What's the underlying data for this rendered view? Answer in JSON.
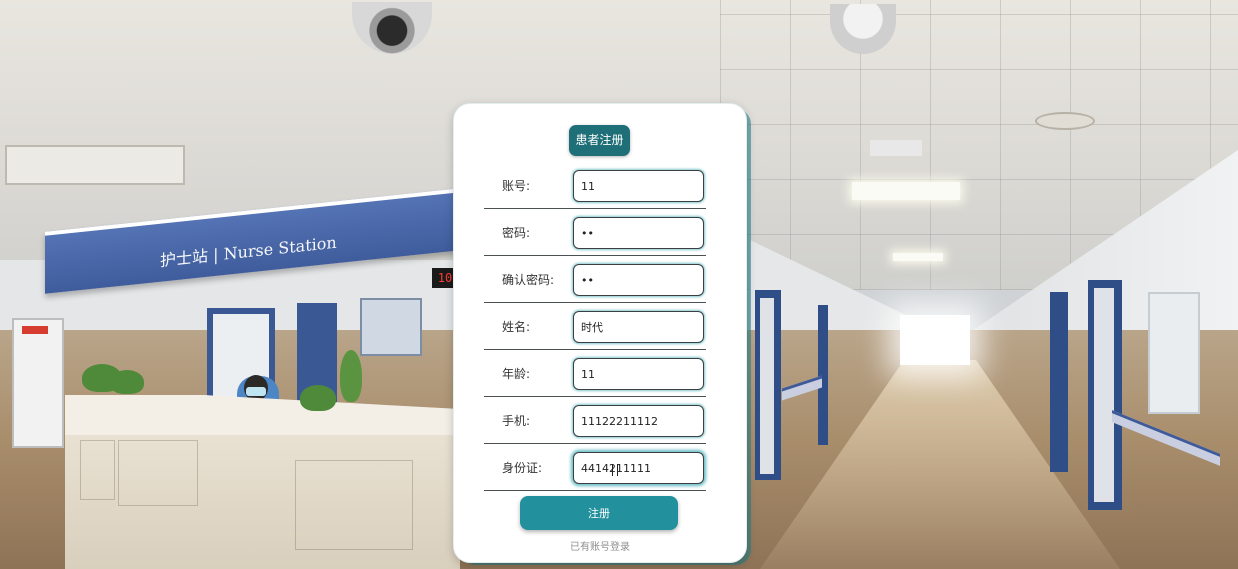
{
  "background": {
    "sign_text": "护士站 | Nurse Station",
    "clock_text": "10"
  },
  "form": {
    "title": "患者注册",
    "fields": [
      {
        "label": "账号:",
        "value": "11",
        "type": "text"
      },
      {
        "label": "密码:",
        "value": "••",
        "type": "password"
      },
      {
        "label": "确认密码:",
        "value": "••",
        "type": "password"
      },
      {
        "label": "姓名:",
        "value": "时代",
        "type": "text"
      },
      {
        "label": "年龄:",
        "value": "11",
        "type": "text"
      },
      {
        "label": "手机:",
        "value": "11122211112",
        "type": "text"
      },
      {
        "label": "身份证:",
        "value": "4414211111",
        "type": "text"
      }
    ],
    "submit_label": "注册",
    "login_link": "已有账号登录"
  },
  "colors": {
    "accent": "#23919d",
    "title_bg": "#1e6f78"
  }
}
